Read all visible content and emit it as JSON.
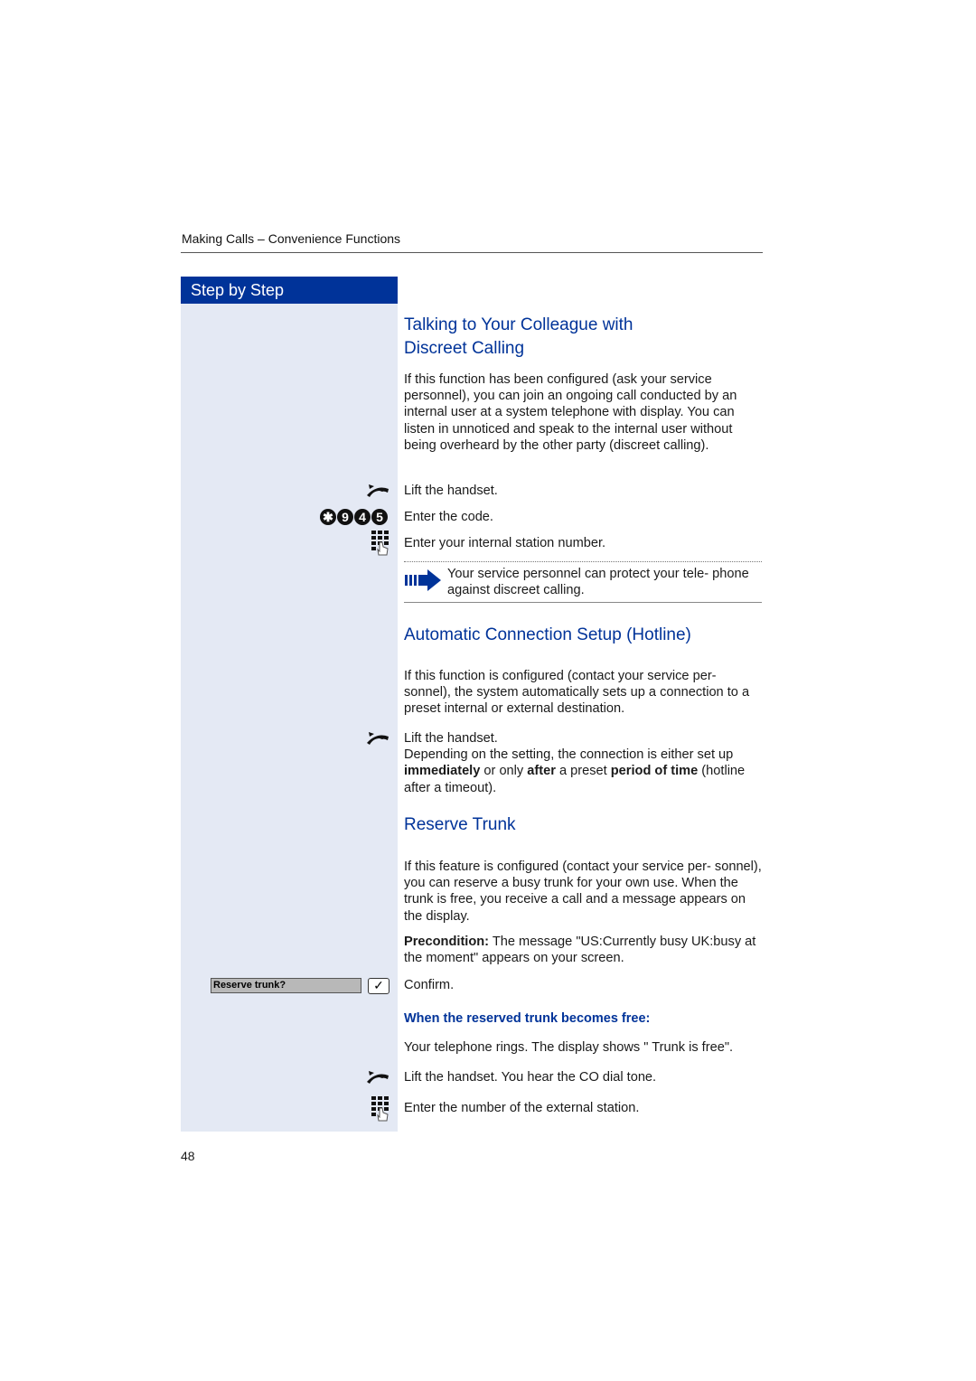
{
  "header": {
    "running_head": "Making Calls – Convenience Functions"
  },
  "sidebar": {
    "title": "Step by Step",
    "display_prompt": "Reserve trunk?",
    "confirm_glyph": "✓",
    "code_keys": [
      "✱",
      "9",
      "4",
      "5"
    ]
  },
  "section1": {
    "title_line1": "Talking to Your Colleague with",
    "title_line2": "Discreet Calling",
    "intro": "If this function has been configured (ask your service personnel), you can join an ongoing call conducted by an internal user at a system telephone with display. You can listen in unnoticed and speak to the internal user without being overheard by the other party (discreet calling).",
    "steps": [
      {
        "icon": "lift-handset-icon",
        "text": "Lift the handset."
      },
      {
        "icon": "code-keys-icon",
        "text": "Enter the code."
      },
      {
        "icon": "keypad-icon",
        "text": "Enter your internal station number."
      }
    ],
    "note": "Your service personnel can protect your tele- phone against discreet calling."
  },
  "section2": {
    "title": "Automatic Connection Setup (Hotline)",
    "intro": "If this function is configured (contact your service per- sonnel), the system automatically sets up a connection to a preset internal or external destination.",
    "step_text": "Lift the handset.",
    "detail_pre": "Depending on the setting, the connection is either set up ",
    "detail_b1": "immediately",
    "detail_mid1": " or only ",
    "detail_b2": "after",
    "detail_mid2": " a preset ",
    "detail_b3": "period of time",
    "detail_post": " (hotline after a timeout)."
  },
  "section3": {
    "title": "Reserve Trunk",
    "intro": "If this feature is configured (contact your service per- sonnel), you can reserve a busy trunk for your own use. When the trunk is free, you receive a call and a message appears on the display.",
    "precondition_label": "Precondition:",
    "precondition_text": " The message \"US:Currently busy UK:busy at the moment\" appears on your screen.",
    "confirm_text": "Confirm.",
    "subhead": "When the reserved trunk becomes free:",
    "rings_text": "Your telephone rings. The display shows \" Trunk is free\".",
    "lift_text": "Lift the handset. You hear the CO dial tone.",
    "enter_text": "Enter the number of the external station."
  },
  "footer": {
    "page_number": "48"
  }
}
